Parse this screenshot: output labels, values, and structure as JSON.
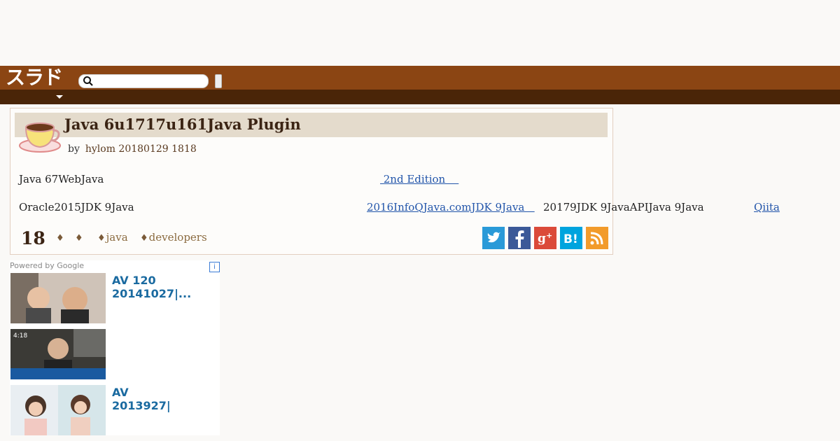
{
  "site": {
    "logo_text": "スラド"
  },
  "search": {
    "placeholder": ""
  },
  "article": {
    "title": "Java 6u1717u161Java Plugin",
    "byline_by": "by",
    "byline_meta": "hylom 20180129 1818",
    "paragraph1_text": "Java 67WebJava",
    "paragraph1_link": " 2nd Edition    ",
    "paragraph2_text": "Oracle2015JDK 9Java",
    "paragraph2_link": "2016InfoQJava.comJDK 9Java   ",
    "paragraph2_text2": "20179JDK 9JavaAPIJava 9Java",
    "paragraph2_link2": "Qiita",
    "comment_count": "18",
    "tags": [
      "",
      "",
      "java",
      "developers"
    ]
  },
  "share": {
    "twitter": "twitter-icon",
    "facebook": "facebook-icon",
    "googleplus": "google-plus-icon",
    "hatena": "hatena-bookmark-icon",
    "rss": "rss-icon",
    "twitter_color": "#2a9ad8",
    "facebook_color": "#3b5998",
    "googleplus_color": "#db4a39",
    "hatena_color": "#00a4de",
    "rss_color": "#f29b2b"
  },
  "ads": {
    "powered_by": "Powered by Google",
    "info_label": "i",
    "items": [
      {
        "title": "AV 120\n20141027|..."
      },
      {
        "title": ""
      },
      {
        "title": "AV\n2013927|"
      }
    ]
  },
  "colors": {
    "header": "#8b4513",
    "subbar": "#4a2508",
    "link": "#2255aa"
  }
}
